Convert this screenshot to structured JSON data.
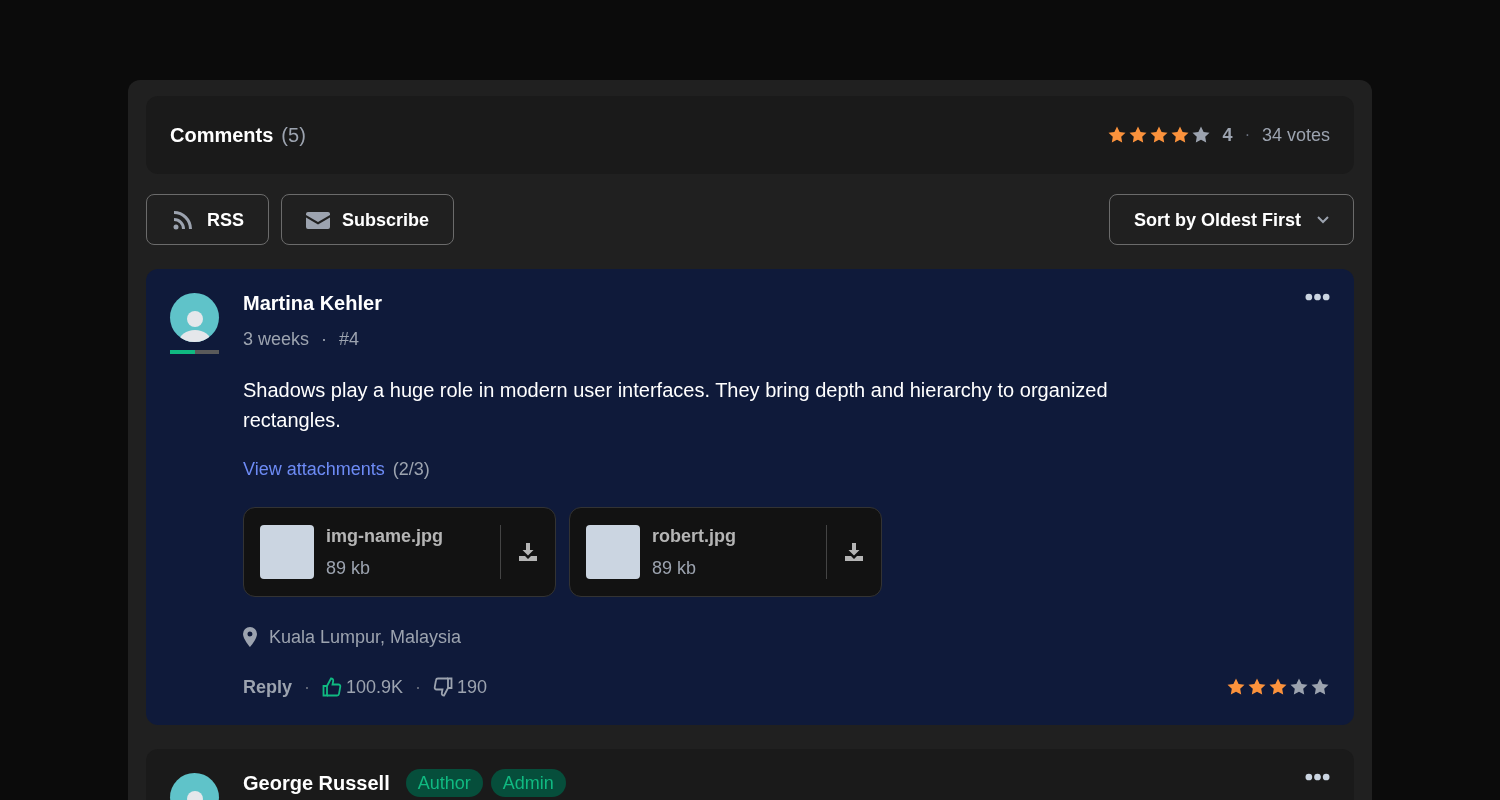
{
  "header": {
    "title": "Comments",
    "count": "(5)",
    "stars": 4,
    "rating": "4",
    "separator": "·",
    "votes": "34 votes"
  },
  "toolbar": {
    "buttons": [
      {
        "kind": "rss",
        "label": "RSS"
      },
      {
        "kind": "mail",
        "label": "Subscribe"
      }
    ],
    "sort": {
      "label": "Sort by Oldest First"
    }
  },
  "comments": [
    {
      "highlighted": true,
      "author": "Martina Kehler",
      "level": 0.5,
      "time": "3 weeks",
      "separator": "·",
      "number": "#4",
      "text": "Shadows play a huge role in modern user interfaces. They bring depth and hierarchy to organized rectangles.",
      "attachments_link": "View attachments",
      "attachments_count": "(2/3)",
      "attachments": [
        {
          "name": "img-name.jpg",
          "size": "89 kb"
        },
        {
          "name": "robert.jpg",
          "size": "89 kb"
        }
      ],
      "location": "Kuala Lumpur, Malaysia",
      "reply": "Reply",
      "likes": "100.9K",
      "dislikes": "190",
      "stars": 3
    },
    {
      "highlighted": false,
      "author": "George Russell",
      "badges": [
        "Author",
        "Admin"
      ]
    }
  ]
}
